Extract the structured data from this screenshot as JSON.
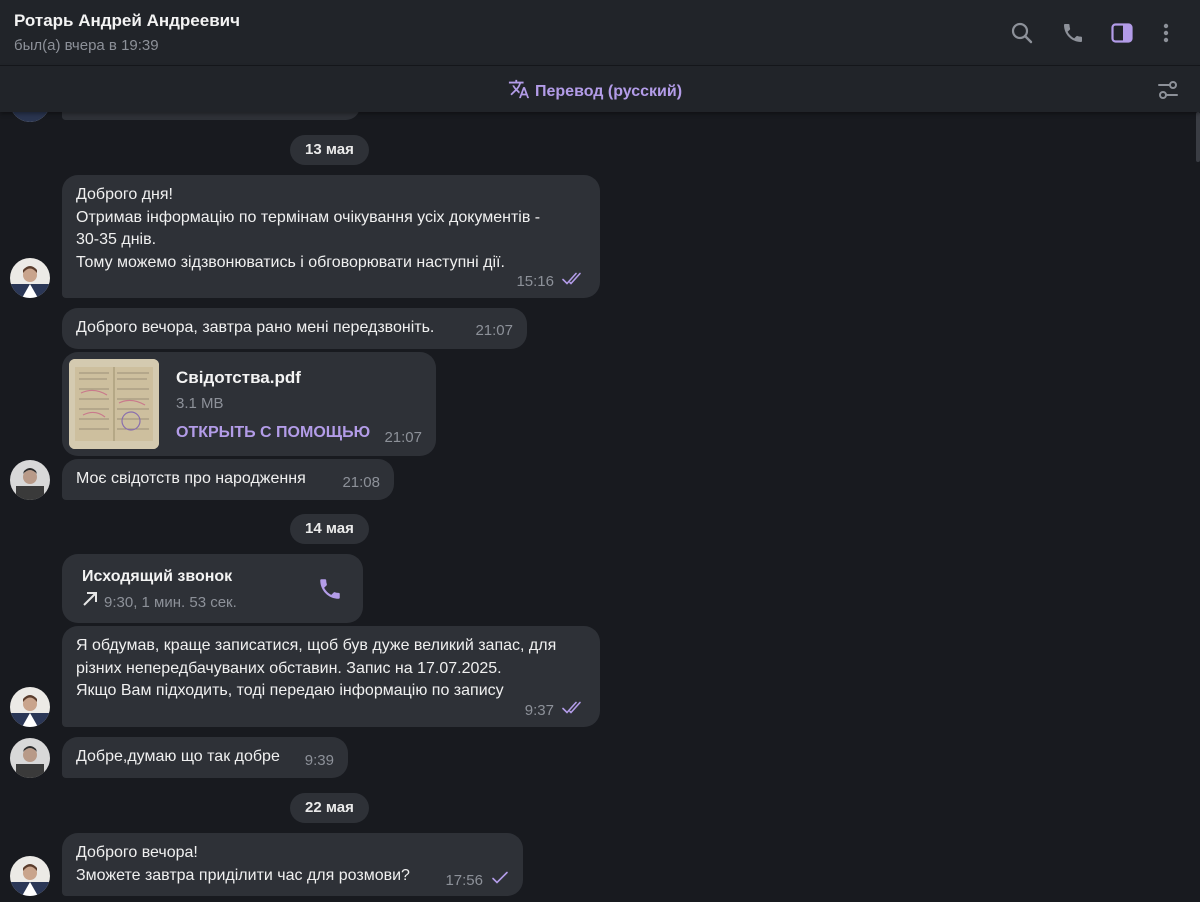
{
  "header": {
    "name": "Ротарь Андрей Андреевич",
    "status": "был(а) вчера в 19:39",
    "icons": [
      "search-icon",
      "phone-icon",
      "sidebar-toggle-icon",
      "more-vertical-icon"
    ]
  },
  "translate_bar": {
    "label": "Перевод (русский)",
    "icons": [
      "translate-icon",
      "sliders-icon"
    ]
  },
  "dates": [
    "13 мая",
    "14 мая",
    "22 мая"
  ],
  "messages": {
    "m1": {
      "text": "Доброго дня!\nОтримав інформацію по термінам очікування усіх документів -\n30-35 днів.\nТому можемо зідзвонюватись і обговорювати наступні дії.",
      "time": "15:16",
      "status": "read"
    },
    "m2": {
      "text": "Доброго вечора, завтра рано мені передзвоніть.",
      "time": "21:07"
    },
    "file": {
      "name": "Свідотства.pdf",
      "size": "3.1 MB",
      "action": "ОТКРЫТЬ С ПОМОЩЬЮ",
      "time": "21:07"
    },
    "m3": {
      "text": "Моє свідотств про народження",
      "time": "21:08"
    },
    "call": {
      "title": "Исходящий звонок",
      "info": "9:30, 1 мин. 53 сек."
    },
    "m4": {
      "text": "Я обдумав, краще записатися, щоб був дуже великий запас, для\nрізних непередбачуваних обставин. Запис  на 17.07.2025.\nЯкщо Вам підходить, тоді передаю інформацію по запису",
      "time": "9:37",
      "status": "read"
    },
    "m5": {
      "text": "Добре,думаю що так добре",
      "time": "9:39"
    },
    "m6": {
      "text": "Доброго вечора!\nЗможете завтра приділити час для розмови?",
      "time": "17:56",
      "status": "sent"
    }
  },
  "colors": {
    "accent": "#b39ce8",
    "bubble": "#2e3137",
    "background": "#181a1f",
    "header": "#212429",
    "muted": "#8d9199"
  }
}
